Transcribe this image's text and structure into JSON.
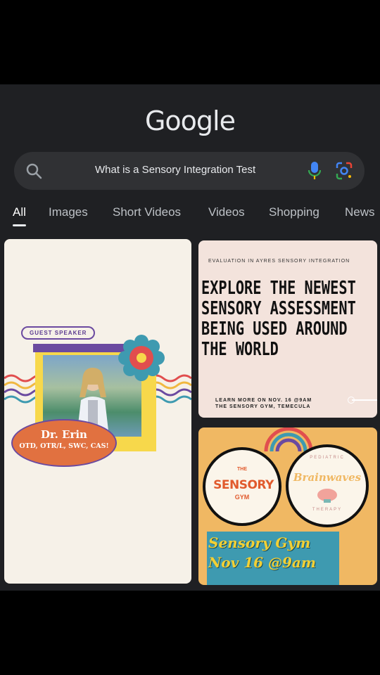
{
  "app": {
    "logo": "Google"
  },
  "search": {
    "query": "What is a Sensory Integration Test"
  },
  "tabs": [
    {
      "label": "All"
    },
    {
      "label": "Images"
    },
    {
      "label": "Short Videos"
    },
    {
      "label": "Videos"
    },
    {
      "label": "Shopping"
    },
    {
      "label": "News"
    }
  ],
  "results": [
    {
      "guest_label": "GUEST SPEAKER",
      "name": "Dr. Erin",
      "credentials": "OTD, OTR/L, SWC, CAS!"
    },
    {
      "eyebrow": "EVALUATION IN AYRES SENSORY INTEGRATION",
      "headline": "EXPLORE THE NEWEST SENSORY ASSESSMENT BEING USED AROUND THE WORLD",
      "learn_line1": "LEARN MORE ON NOV. 16 @9AM",
      "learn_line2": "THE SENSORY GYM, TEMECULA"
    },
    {
      "logo1_top": "THE",
      "logo1_main": "SENSORY",
      "logo1_bottom": "GYM",
      "logo2_top": "PEDIATRIC",
      "logo2_main": "Brainwaves",
      "logo2_bottom": "THERAPY",
      "title_line1": "Sensory Gym",
      "title_line2": "Nov 16 @9am"
    }
  ],
  "colors": {
    "accent_purple": "#6b4aa0",
    "orange": "#e17140",
    "yellow": "#f7d84b",
    "teal": "#3e9ab0"
  },
  "icons": [
    "search-icon",
    "mic-icon",
    "lens-icon"
  ]
}
